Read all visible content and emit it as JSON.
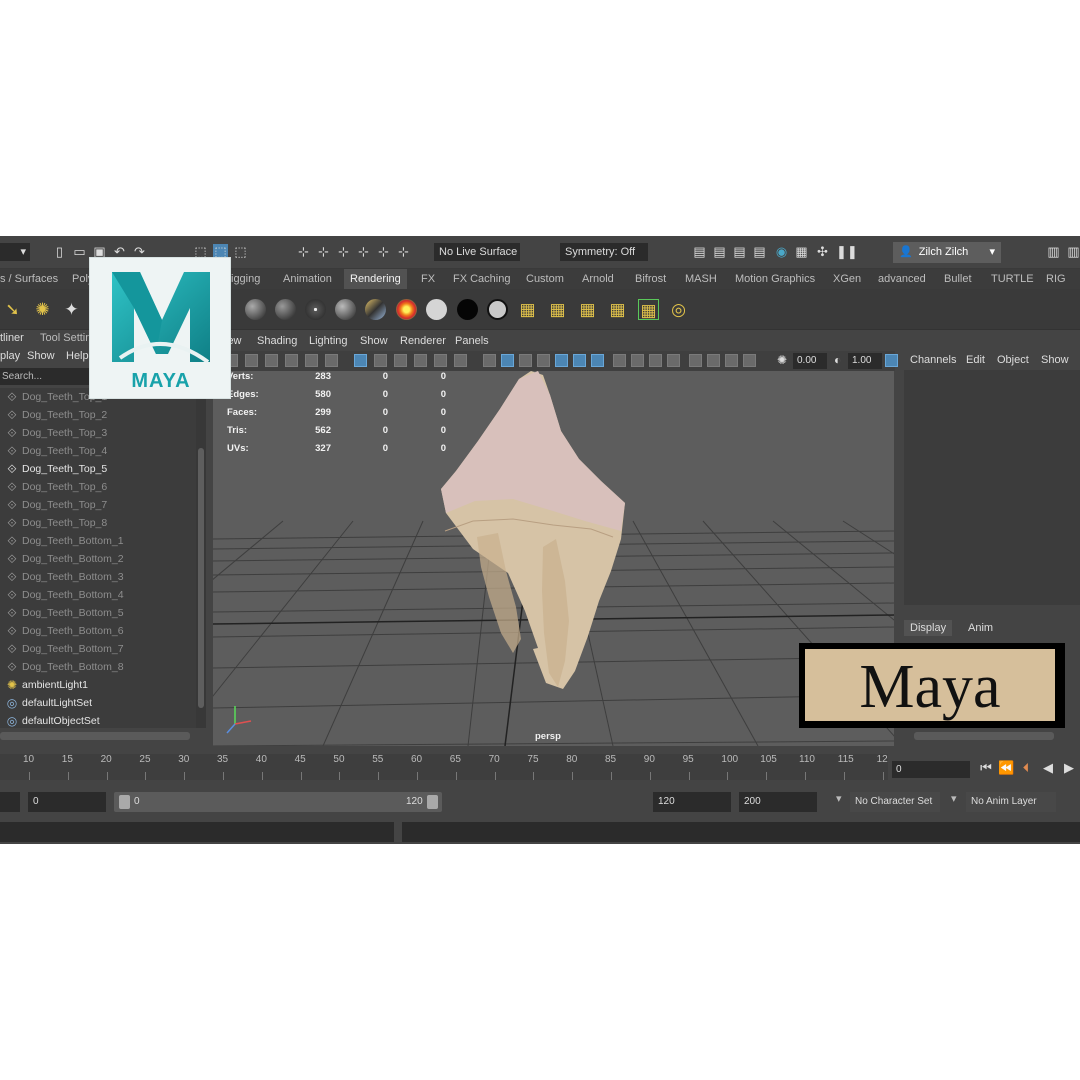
{
  "status_line": {
    "live_surface": "No Live Surface",
    "symmetry": "Symmetry: Off",
    "user": "Zilch Zilch"
  },
  "shelf_tabs": [
    "s / Surfaces",
    "Poly",
    "igging",
    "Animation",
    "Rendering",
    "FX",
    "FX Caching",
    "Custom",
    "Arnold",
    "Bifrost",
    "MASH",
    "Motion Graphics",
    "XGen",
    "advanced",
    "Bullet",
    "TURTLE",
    "RIG"
  ],
  "active_shelf_tab": "Rendering",
  "outliner": {
    "tabs": [
      "tliner",
      "Tool Settin"
    ],
    "menu": [
      "play",
      "Show",
      "Help"
    ],
    "search_placeholder": "Search...",
    "items": [
      {
        "label": "Dog_Teeth_Top_1",
        "icon": "transform-icon"
      },
      {
        "label": "Dog_Teeth_Top_2",
        "icon": "transform-icon"
      },
      {
        "label": "Dog_Teeth_Top_3",
        "icon": "transform-icon"
      },
      {
        "label": "Dog_Teeth_Top_4",
        "icon": "transform-icon"
      },
      {
        "label": "Dog_Teeth_Top_5",
        "icon": "transform-icon"
      },
      {
        "label": "Dog_Teeth_Top_6",
        "icon": "transform-icon"
      },
      {
        "label": "Dog_Teeth_Top_7",
        "icon": "transform-icon"
      },
      {
        "label": "Dog_Teeth_Top_8",
        "icon": "transform-icon"
      },
      {
        "label": "Dog_Teeth_Bottom_1",
        "icon": "transform-icon"
      },
      {
        "label": "Dog_Teeth_Bottom_2",
        "icon": "transform-icon"
      },
      {
        "label": "Dog_Teeth_Bottom_3",
        "icon": "transform-icon"
      },
      {
        "label": "Dog_Teeth_Bottom_4",
        "icon": "transform-icon"
      },
      {
        "label": "Dog_Teeth_Bottom_5",
        "icon": "transform-icon"
      },
      {
        "label": "Dog_Teeth_Bottom_6",
        "icon": "transform-icon"
      },
      {
        "label": "Dog_Teeth_Bottom_7",
        "icon": "transform-icon"
      },
      {
        "label": "Dog_Teeth_Bottom_8",
        "icon": "transform-icon"
      },
      {
        "label": "ambientLight1",
        "icon": "light-icon"
      },
      {
        "label": "defaultLightSet",
        "icon": "set-icon"
      },
      {
        "label": "defaultObjectSet",
        "icon": "set-icon"
      }
    ]
  },
  "viewport": {
    "menu": [
      "iew",
      "Shading",
      "Lighting",
      "Show",
      "Renderer",
      "Panels"
    ],
    "near_value": "0.00",
    "far_value": "1.00",
    "hud": [
      {
        "label": "Verts:",
        "values": [
          "283",
          "0",
          "0"
        ]
      },
      {
        "label": "Edges:",
        "values": [
          "580",
          "0",
          "0"
        ]
      },
      {
        "label": "Faces:",
        "values": [
          "299",
          "0",
          "0"
        ]
      },
      {
        "label": "Tris:",
        "values": [
          "562",
          "0",
          "0"
        ]
      },
      {
        "label": "UVs:",
        "values": [
          "327",
          "0",
          "0"
        ]
      }
    ],
    "camera": "persp"
  },
  "channel_box": {
    "menu": [
      "Channels",
      "Edit",
      "Object",
      "Show"
    ],
    "layer_tabs": [
      "Display",
      "Anim"
    ]
  },
  "time_slider": {
    "ticks": [
      "10",
      "15",
      "20",
      "25",
      "30",
      "35",
      "40",
      "45",
      "50",
      "55",
      "60",
      "65",
      "70",
      "75",
      "80",
      "85",
      "90",
      "95",
      "100",
      "105",
      "110",
      "115",
      "12"
    ],
    "current_frame": "0"
  },
  "range_slider": {
    "start": "0",
    "range_start": "0",
    "range_end": "120",
    "end": "120",
    "total_end": "200",
    "character_set": "No Character Set",
    "anim_layer": "No Anim Layer"
  },
  "overlays": {
    "logo_text": "MAYA",
    "caption": "Maya"
  },
  "colors": {
    "ui_background": "#444444",
    "viewport": "#5d5d5d",
    "highlight": "#4c86b4",
    "logo_teal": "#18a2aa",
    "caption_fill": "#d6bf9b"
  }
}
